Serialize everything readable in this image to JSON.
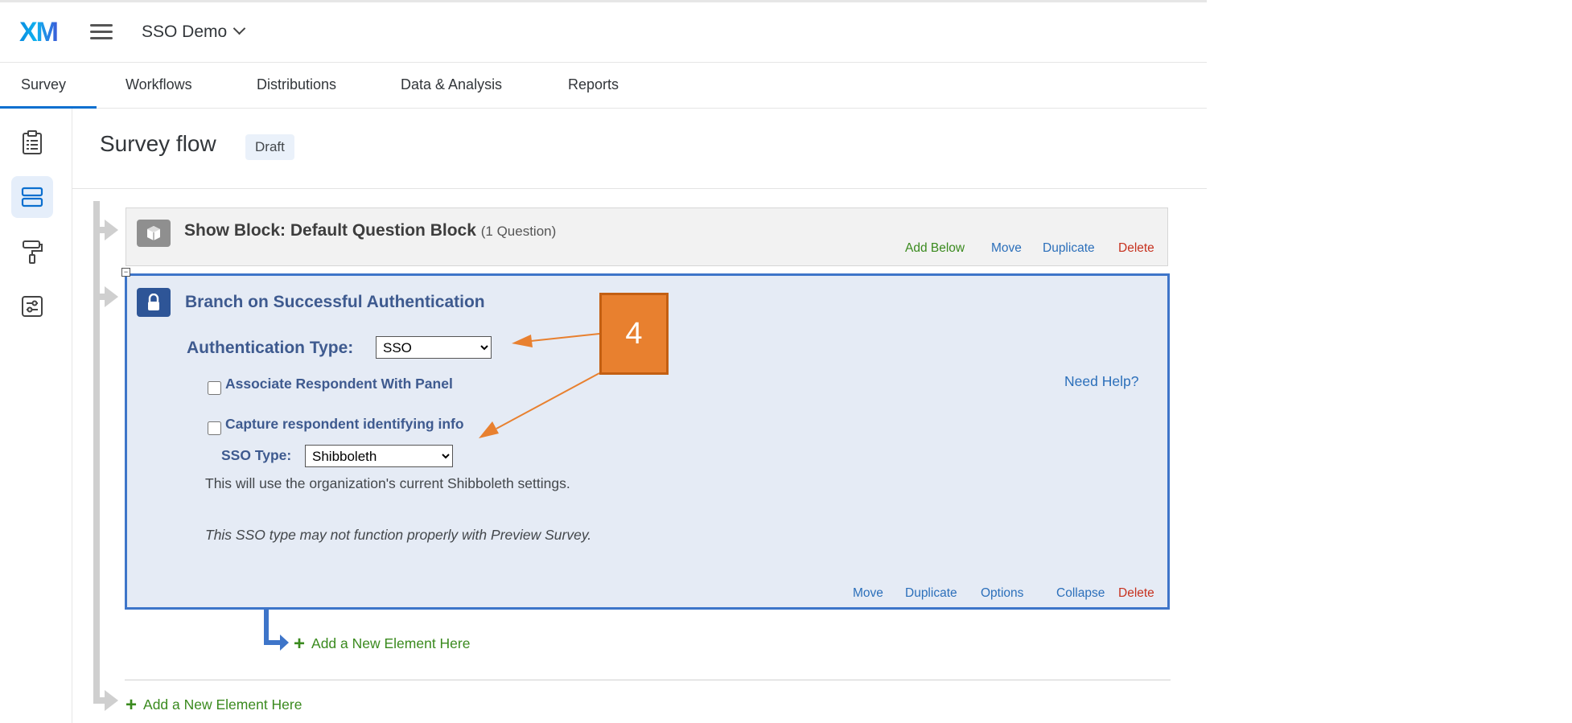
{
  "header": {
    "project_name": "SSO Demo"
  },
  "tabs": [
    "Survey",
    "Workflows",
    "Distributions",
    "Data & Analysis",
    "Reports"
  ],
  "page": {
    "title": "Survey flow",
    "status_badge": "Draft"
  },
  "block1": {
    "title": "Show Block: Default Question Block",
    "count": "(1 Question)",
    "actions": {
      "add_below": "Add Below",
      "move": "Move",
      "duplicate": "Duplicate",
      "delete": "Delete"
    }
  },
  "block2": {
    "title": "Branch on Successful Authentication",
    "auth_label": "Authentication Type:",
    "auth_value": "SSO",
    "checkbox1": "Associate Respondent With Panel",
    "checkbox2": "Capture respondent identifying info",
    "sso_label": "SSO Type:",
    "sso_value": "Shibboleth",
    "note": "This will use the organization's current Shibboleth settings.",
    "warning": "This SSO type may not function properly with Preview Survey.",
    "help": "Need Help?",
    "actions": {
      "move": "Move",
      "duplicate": "Duplicate",
      "options": "Options",
      "collapse": "Collapse",
      "delete": "Delete"
    }
  },
  "add_new_inner": "Add a New Element Here",
  "add_new_outer": "Add a New Element Here",
  "callout": {
    "number": "4",
    "color": "#e8802f"
  },
  "colors": {
    "accent": "#0b6fcf",
    "branch_border": "#3e75c9",
    "add_green": "#3a8a1e",
    "delete_red": "#c7321f"
  }
}
